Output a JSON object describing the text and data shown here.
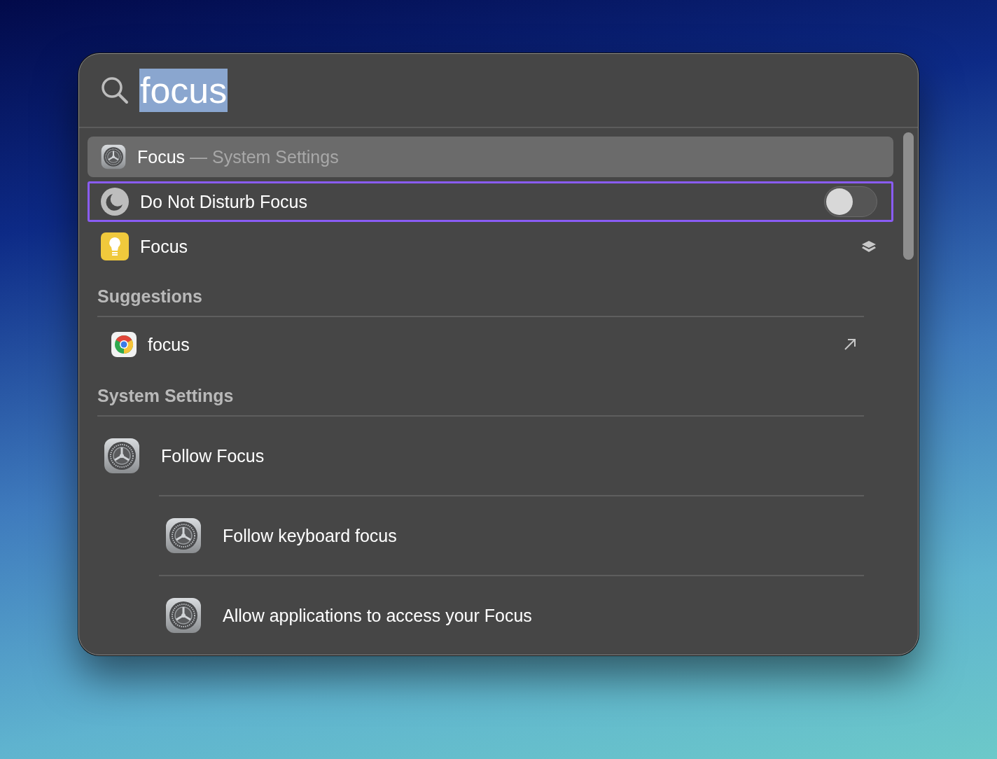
{
  "search": {
    "value": "focus",
    "text_selected": true
  },
  "top_hits": [
    {
      "kind": "settings",
      "title": "Focus",
      "subtitle": "— System Settings",
      "selected": true,
      "outlined": false
    },
    {
      "kind": "toggle",
      "title": "Do Not Disturb Focus",
      "on": false,
      "selected": false,
      "outlined": true
    },
    {
      "kind": "app",
      "title": "Focus",
      "selected": false,
      "outlined": false
    }
  ],
  "sections": [
    {
      "title": "Suggestions",
      "items": [
        {
          "kind": "web",
          "title": "focus"
        }
      ]
    },
    {
      "title": "System Settings",
      "items": [
        {
          "kind": "setting",
          "title": "Follow Focus"
        },
        {
          "kind": "setting",
          "title": "Follow keyboard focus"
        },
        {
          "kind": "setting",
          "title": "Allow applications to access your Focus"
        }
      ]
    }
  ]
}
